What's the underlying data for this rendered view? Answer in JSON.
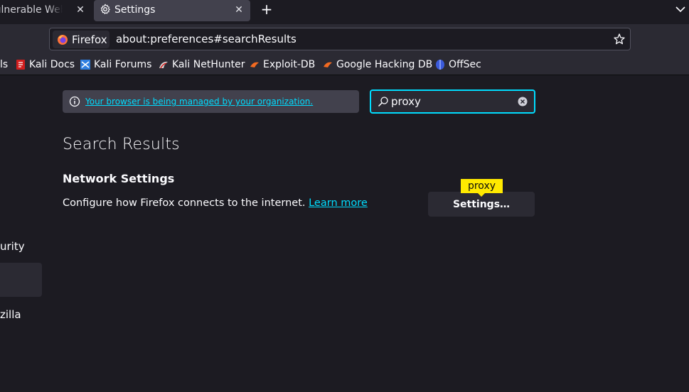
{
  "tabs": {
    "inactive_label": "Vulnerable Web Application",
    "active_label": "Settings"
  },
  "navbar": {
    "identity_label": "Firefox",
    "url": "about:preferences#searchResults"
  },
  "bookmarks": [
    {
      "label": "ls",
      "icon": "kali-icon"
    },
    {
      "label": "Kali Docs",
      "icon": "kali-docs-icon"
    },
    {
      "label": "Kali Forums",
      "icon": "kali-forums-icon"
    },
    {
      "label": "Kali NetHunter",
      "icon": "nethunter-icon"
    },
    {
      "label": "Exploit-DB",
      "icon": "exploitdb-icon"
    },
    {
      "label": "Google Hacking DB",
      "icon": "ghdb-icon"
    },
    {
      "label": "OffSec",
      "icon": "offsec-icon"
    }
  ],
  "content": {
    "managed_notice": "Your browser is being managed by your organization.",
    "search_value": "proxy",
    "results_title": "Search Results",
    "section_title": "Network Settings",
    "section_desc": "Configure how Firefox connects to the internet.",
    "learn_more": "Learn more",
    "settings_button": "Settings…",
    "tooltip": "proxy"
  },
  "sidebar": {
    "item_privacy_partial": "urity",
    "item_mozilla_partial": "zilla"
  },
  "colors": {
    "accent": "#00ddff",
    "tooltip": "#ffe900",
    "background": "#1c1b22",
    "toolbar": "#2b2a33"
  }
}
